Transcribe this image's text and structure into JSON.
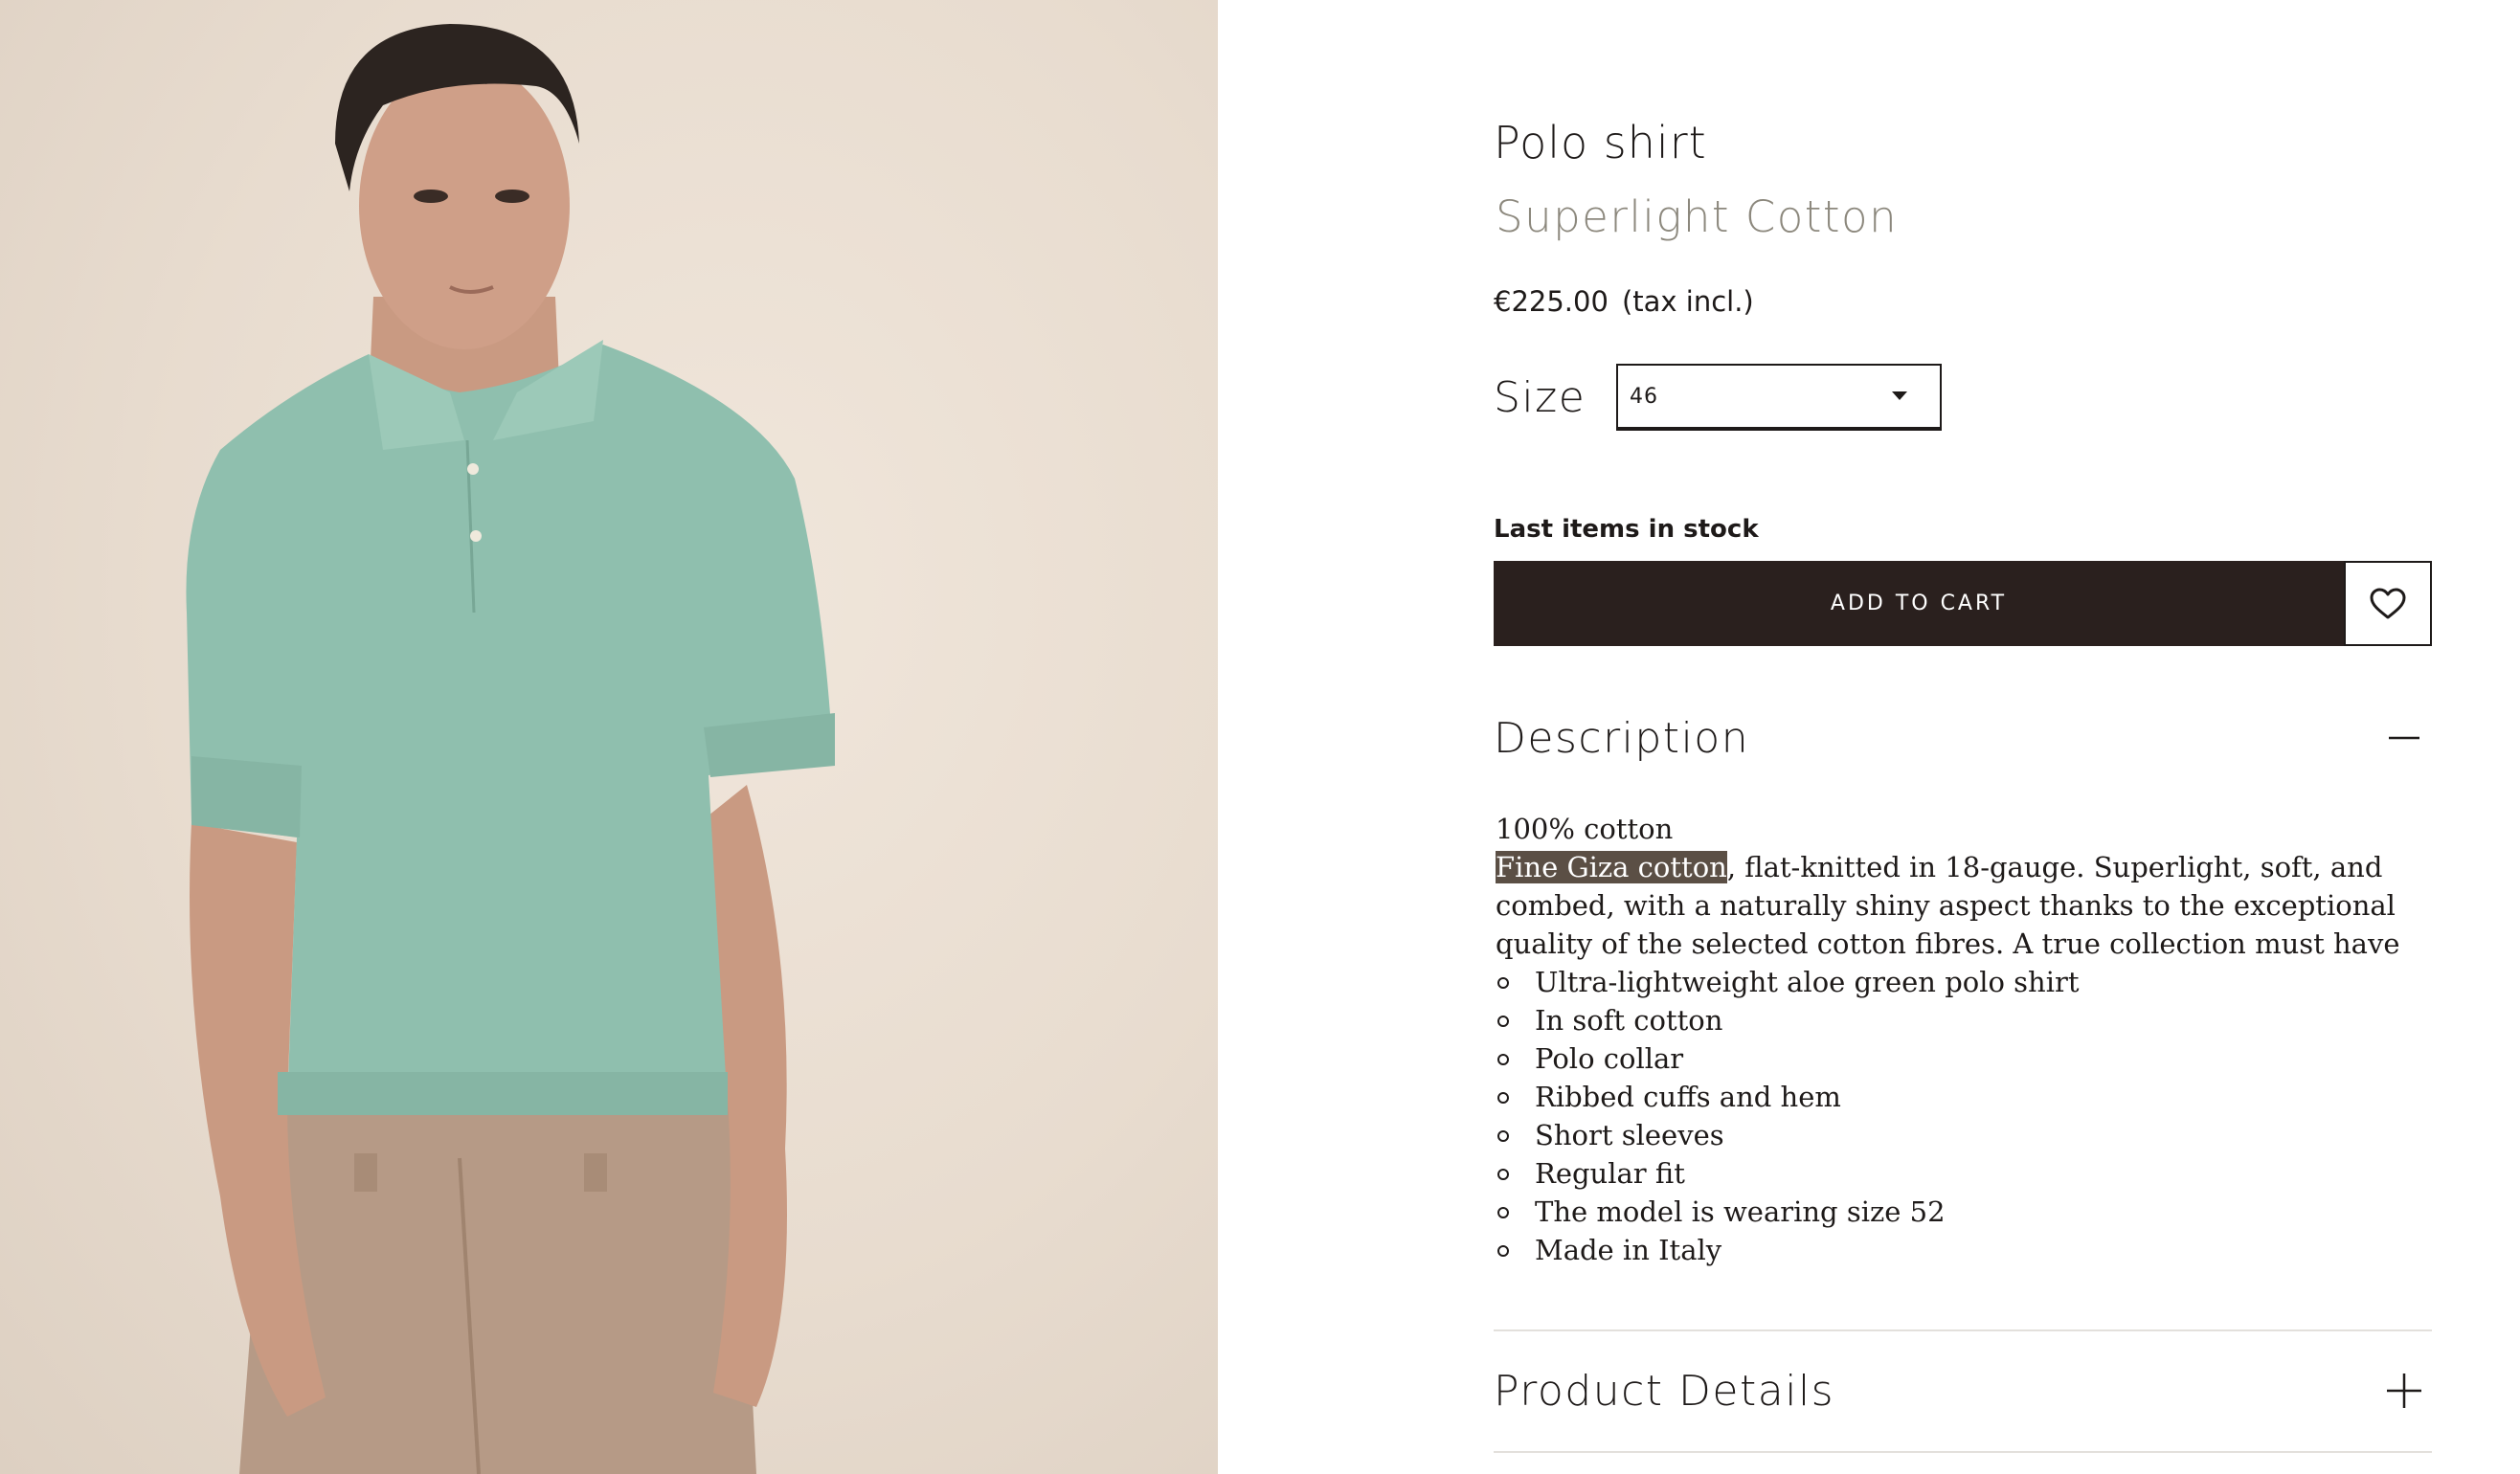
{
  "product": {
    "title": "Polo shirt",
    "subtitle": "Superlight Cotton",
    "price": "€225.00",
    "tax_note": "(tax incl.)",
    "size_label": "Size",
    "size_value": "46",
    "stock_status": "Last items in stock",
    "add_to_cart_label": "ADD TO CART",
    "wishlist_icon": "heart-icon",
    "image_icon": "product-photo"
  },
  "description": {
    "heading": "Description",
    "toggle_icon": "minus-icon",
    "composition": "100% cotton",
    "highlight": "Fine Giza cotton",
    "paragraph_rest": ", flat-knitted in 18-gauge. Superlight, soft, and combed, with a naturally shiny aspect thanks to the exceptional quality of the selected cotton fibres. A true collection must have",
    "features": [
      "Ultra-lightweight aloe green polo shirt",
      "In soft cotton",
      "Polo collar",
      "Ribbed cuffs and hem",
      "Short sleeves",
      "Regular fit",
      "The model is wearing size 52",
      "Made in Italy"
    ]
  },
  "details": {
    "heading": "Product Details",
    "toggle_icon": "plus-icon"
  },
  "colors": {
    "accent_dark": "#2a201e",
    "subtitle_gray": "#8c887d",
    "highlight_bg": "#5b4f45",
    "shirt_green": "#8fbfae",
    "background": "#e8dccf"
  }
}
